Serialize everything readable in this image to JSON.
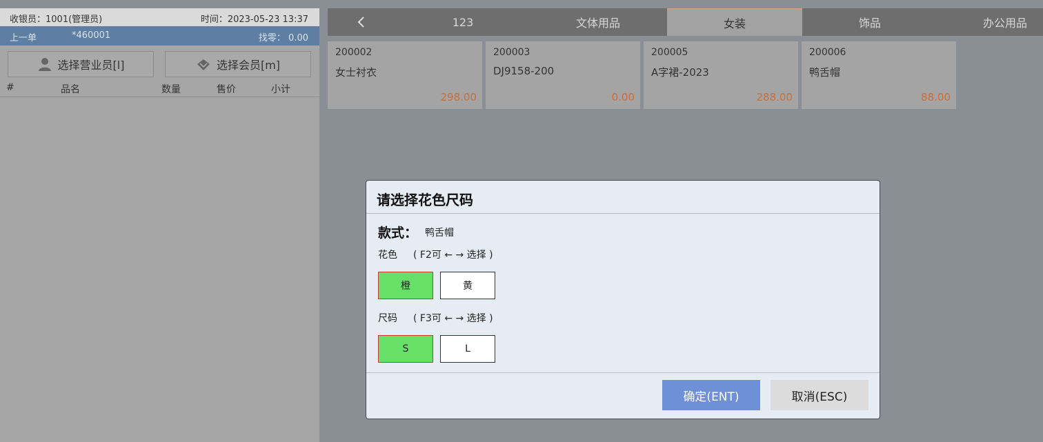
{
  "left": {
    "cashier": "收银员：1001(管理员)",
    "time": "时间：2023-05-23 13:37",
    "last_order_label": "上一单",
    "last_order_no": "*460001",
    "change": "找零： 0.00",
    "select_staff": "选择营业员[l]",
    "select_member": "选择会员[m]",
    "columns": [
      "#",
      "品名",
      "数量",
      "售价",
      "小计"
    ]
  },
  "tabs": [
    "123",
    "文体用品",
    "女装",
    "饰品",
    "办公用品"
  ],
  "active_tab": "女装",
  "products": [
    {
      "code": "200002",
      "name": "女士衬衣",
      "price": "298.00"
    },
    {
      "code": "200003",
      "name": "DJ9158-200",
      "price": "0.00"
    },
    {
      "code": "200005",
      "name": "A字裙-2023",
      "price": "288.00"
    },
    {
      "code": "200006",
      "name": "鸭舌帽",
      "price": "88.00"
    }
  ],
  "dialog": {
    "title": "请选择花色尺码",
    "style_label": "款式：",
    "style_value": "鸭舌帽",
    "color_label": "花色",
    "color_hint": "( F2可 ←   → 选择 )",
    "colors": [
      "橙",
      "黄"
    ],
    "size_label": "尺码",
    "size_hint": "( F3可 ←   → 选择 )",
    "sizes": [
      "S",
      "L"
    ],
    "ok": "确定(ENT)",
    "cancel": "取消(ESC)"
  },
  "colors": {
    "selected_option": "#66e066",
    "ok_button": "#6f8fd6",
    "price": "#c7703b"
  }
}
